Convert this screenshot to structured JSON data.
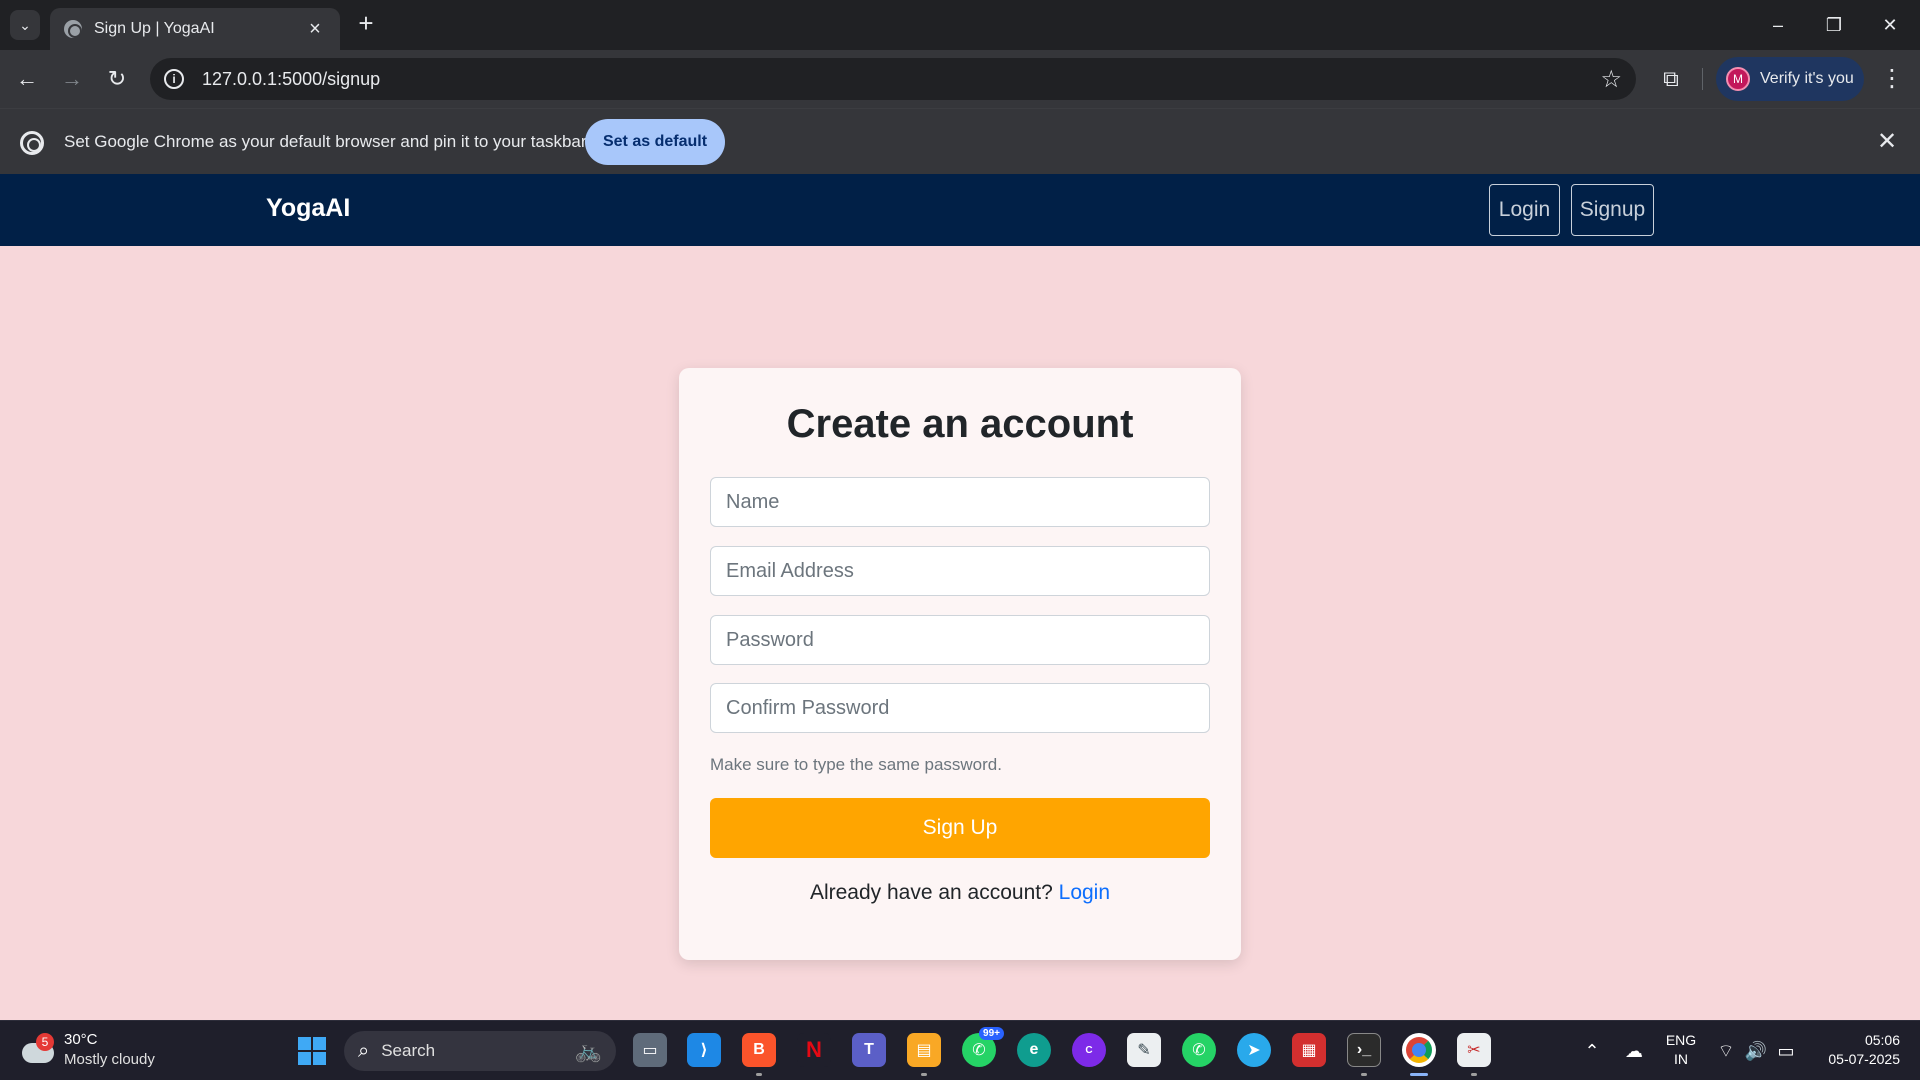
{
  "browser": {
    "tab_title": "Sign Up | YogaAI",
    "url": "127.0.0.1:5000/signup",
    "profile_initial": "M",
    "profile_label": "Verify it's you",
    "infobar_message": "Set Google Chrome as your default browser and pin it to your taskbar",
    "infobar_button": "Set as default"
  },
  "site": {
    "brand": "YogaAI",
    "nav": {
      "login": "Login",
      "signup": "Signup"
    }
  },
  "form": {
    "title": "Create an account",
    "fields": {
      "name_placeholder": "Name",
      "email_placeholder": "Email Address",
      "password_placeholder": "Password",
      "confirm_placeholder": "Confirm Password"
    },
    "help_text": "Make sure to type the same password.",
    "submit_label": "Sign Up",
    "login_prompt": "Already have an account?",
    "login_link": "Login"
  },
  "taskbar": {
    "weather_badge": "5",
    "weather_temp": "30°C",
    "weather_desc": "Mostly cloudy",
    "search_label": "Search",
    "whatsapp_badge": "99+",
    "lang_top": "ENG",
    "lang_bottom": "IN",
    "time": "05:06",
    "date": "05-07-2025"
  },
  "colors": {
    "page_background": "#f7d7da",
    "navbar": "#012047",
    "signup_button": "#ffa500",
    "link": "#0d6efd"
  }
}
